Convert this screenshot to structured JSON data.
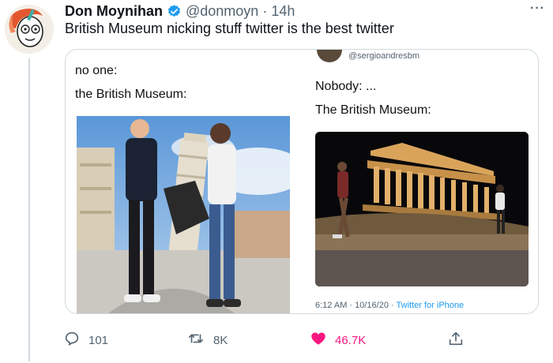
{
  "tweet": {
    "author_name": "Don Moynihan",
    "handle": "@donmoyn",
    "separator": "·",
    "time": "14h",
    "more_label": "···",
    "text": "British Museum nicking stuff twitter is the best twitter"
  },
  "quote": {
    "left": {
      "line1": "no one:",
      "line2": "the British Museum:"
    },
    "right": {
      "handle": "@sergioandresbm",
      "line1": "Nobody: ...",
      "line2": "The British Museum:",
      "timestamp": "6:12 AM · 10/16/20 · ",
      "source": "Twitter for iPhone"
    }
  },
  "actions": {
    "reply_count": "101",
    "retweet_count": "8K",
    "like_count": "46.7K"
  },
  "colors": {
    "like": "#f91880",
    "verified": "#1d9bf0",
    "muted": "#536471"
  },
  "icons": {
    "reply": "speech-bubble-icon",
    "retweet": "retweet-icon",
    "like": "heart-icon",
    "share": "share-icon",
    "verified": "verified-badge-icon",
    "more": "more-icon"
  }
}
